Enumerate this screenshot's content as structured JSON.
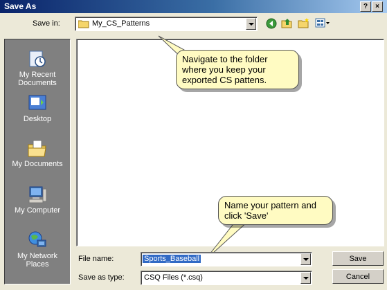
{
  "window": {
    "title": "Save As",
    "help_label": "?",
    "close_label": "×"
  },
  "toolbar": {
    "save_in_label": "Save in:",
    "save_in_value": "My_CS_Patterns"
  },
  "places": [
    {
      "label_line1": "My Recent",
      "label_line2": "Documents",
      "icon": "recent-documents-icon"
    },
    {
      "label_line1": "Desktop",
      "label_line2": "",
      "icon": "desktop-icon"
    },
    {
      "label_line1": "My Documents",
      "label_line2": "",
      "icon": "my-documents-icon"
    },
    {
      "label_line1": "My Computer",
      "label_line2": "",
      "icon": "my-computer-icon"
    },
    {
      "label_line1": "My Network",
      "label_line2": "Places",
      "icon": "network-places-icon"
    }
  ],
  "callouts": {
    "folder_hint": "Navigate to the folder where you keep your exported CS pattens.",
    "name_hint": "Name your pattern and click 'Save'"
  },
  "form": {
    "file_name_label": "File name:",
    "file_name_value": "Sports_Baseball",
    "save_as_type_label": "Save as type:",
    "save_as_type_value": "CSQ Files (*.csq)"
  },
  "buttons": {
    "save_label": "Save",
    "cancel_label": "Cancel"
  },
  "colors": {
    "title_bar": "#0a246a",
    "callout_bg": "#fffbc2",
    "places_bg": "#808080",
    "dialog_bg": "#ece9d8"
  }
}
